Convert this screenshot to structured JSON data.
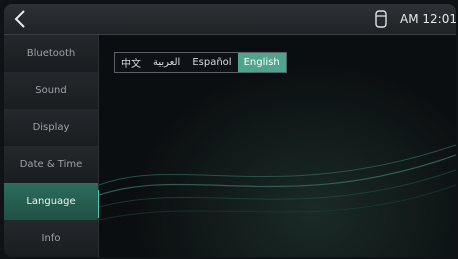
{
  "status": {
    "time": "AM 12:01",
    "usb_icon": "usb-icon"
  },
  "nav": {
    "back_icon": "chevron-left-icon",
    "items": [
      {
        "label": "Bluetooth"
      },
      {
        "label": "Sound"
      },
      {
        "label": "Display"
      },
      {
        "label": "Date & Time"
      },
      {
        "label": "Language"
      },
      {
        "label": "Info"
      }
    ],
    "active": "Language"
  },
  "language": {
    "options": [
      {
        "label": "中文"
      },
      {
        "label": "العربية"
      },
      {
        "label": "Español"
      },
      {
        "label": "English"
      }
    ],
    "selected": "English"
  },
  "colors": {
    "accent": "#4da68b",
    "background": "#0b0d0f"
  }
}
